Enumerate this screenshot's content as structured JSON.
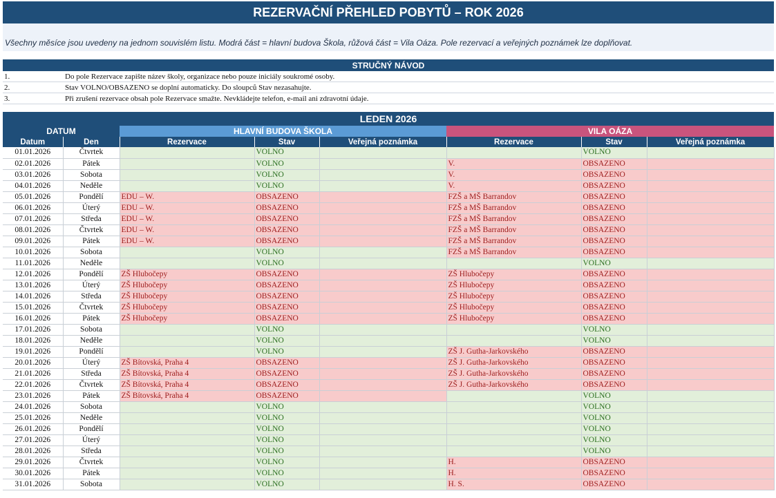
{
  "sheet": {
    "title": "REZERVAČNÍ PŘEHLED POBYTŮ – ROK 2026",
    "description": "Všechny měsíce jsou uvedeny na jednom souvislém listu. Modrá část = hlavní budova Škola, růžová část = Vila Oáza. Pole rezervací a veřejných poznámek lze doplňovat."
  },
  "guide": {
    "title": "STRUČNÝ NÁVOD",
    "items": [
      {
        "num": "1.",
        "text": "Do pole Rezervace zapište název školy, organizace nebo pouze iniciály soukromé osoby."
      },
      {
        "num": "2.",
        "text": "Stav VOLNO/OBSAZENO se doplní automaticky. Do sloupců Stav nezasahujte."
      },
      {
        "num": "3.",
        "text": "Při zrušení rezervace obsah pole Rezervace smažte. Nevkládejte telefon, e-mail ani zdravotní údaje."
      }
    ]
  },
  "month": {
    "title": "LEDEN 2026",
    "groups": {
      "datum": "DATUM",
      "school": "HLAVNÍ BUDOVA ŠKOLA",
      "vila": "VILA OÁZA"
    },
    "headers": [
      "Datum",
      "Den",
      "Rezervace",
      "Stav",
      "Veřejná poznámka",
      "Rezervace",
      "Stav",
      "Veřejná poznámka"
    ],
    "rows": [
      {
        "date": "01.01.2026",
        "day": "Čtvrtek",
        "school_res": "",
        "school_status": "VOLNO",
        "vila_res": "",
        "vila_status": "VOLNO"
      },
      {
        "date": "02.01.2026",
        "day": "Pátek",
        "school_res": "",
        "school_status": "VOLNO",
        "vila_res": "V.",
        "vila_status": "OBSAZENO"
      },
      {
        "date": "03.01.2026",
        "day": "Sobota",
        "school_res": "",
        "school_status": "VOLNO",
        "vila_res": "V.",
        "vila_status": "OBSAZENO"
      },
      {
        "date": "04.01.2026",
        "day": "Neděle",
        "school_res": "",
        "school_status": "VOLNO",
        "vila_res": "V.",
        "vila_status": "OBSAZENO"
      },
      {
        "date": "05.01.2026",
        "day": "Pondělí",
        "school_res": "EDU – W.",
        "school_status": "OBSAZENO",
        "vila_res": "FZŠ a MŠ Barrandov",
        "vila_status": "OBSAZENO"
      },
      {
        "date": "06.01.2026",
        "day": "Úterý",
        "school_res": "EDU – W.",
        "school_status": "OBSAZENO",
        "vila_res": "FZŠ a MŠ Barrandov",
        "vila_status": "OBSAZENO"
      },
      {
        "date": "07.01.2026",
        "day": "Středa",
        "school_res": "EDU – W.",
        "school_status": "OBSAZENO",
        "vila_res": "FZŠ a MŠ Barrandov",
        "vila_status": "OBSAZENO"
      },
      {
        "date": "08.01.2026",
        "day": "Čtvrtek",
        "school_res": "EDU – W.",
        "school_status": "OBSAZENO",
        "vila_res": "FZŠ a MŠ Barrandov",
        "vila_status": "OBSAZENO"
      },
      {
        "date": "09.01.2026",
        "day": "Pátek",
        "school_res": "EDU – W.",
        "school_status": "OBSAZENO",
        "vila_res": "FZŠ a MŠ Barrandov",
        "vila_status": "OBSAZENO"
      },
      {
        "date": "10.01.2026",
        "day": "Sobota",
        "school_res": "",
        "school_status": "VOLNO",
        "vila_res": "FZŠ a MŠ Barrandov",
        "vila_status": "OBSAZENO"
      },
      {
        "date": "11.01.2026",
        "day": "Neděle",
        "school_res": "",
        "school_status": "VOLNO",
        "vila_res": "",
        "vila_status": "VOLNO"
      },
      {
        "date": "12.01.2026",
        "day": "Pondělí",
        "school_res": "ZŠ Hlubočepy",
        "school_status": "OBSAZENO",
        "vila_res": "ZŠ Hlubočepy",
        "vila_status": "OBSAZENO"
      },
      {
        "date": "13.01.2026",
        "day": "Úterý",
        "school_res": "ZŠ Hlubočepy",
        "school_status": "OBSAZENO",
        "vila_res": "ZŠ Hlubočepy",
        "vila_status": "OBSAZENO"
      },
      {
        "date": "14.01.2026",
        "day": "Středa",
        "school_res": "ZŠ Hlubočepy",
        "school_status": "OBSAZENO",
        "vila_res": "ZŠ Hlubočepy",
        "vila_status": "OBSAZENO"
      },
      {
        "date": "15.01.2026",
        "day": "Čtvrtek",
        "school_res": "ZŠ Hlubočepy",
        "school_status": "OBSAZENO",
        "vila_res": "ZŠ Hlubočepy",
        "vila_status": "OBSAZENO"
      },
      {
        "date": "16.01.2026",
        "day": "Pátek",
        "school_res": "ZŠ Hlubočepy",
        "school_status": "OBSAZENO",
        "vila_res": "ZŠ Hlubočepy",
        "vila_status": "OBSAZENO"
      },
      {
        "date": "17.01.2026",
        "day": "Sobota",
        "school_res": "",
        "school_status": "VOLNO",
        "vila_res": "",
        "vila_status": "VOLNO"
      },
      {
        "date": "18.01.2026",
        "day": "Neděle",
        "school_res": "",
        "school_status": "VOLNO",
        "vila_res": "",
        "vila_status": "VOLNO"
      },
      {
        "date": "19.01.2026",
        "day": "Pondělí",
        "school_res": "",
        "school_status": "VOLNO",
        "vila_res": "ZŠ J. Gutha-Jarkovského",
        "vila_status": "OBSAZENO"
      },
      {
        "date": "20.01.2026",
        "day": "Úterý",
        "school_res": "ZŠ Bítovská, Praha 4",
        "school_status": "OBSAZENO",
        "vila_res": "ZŠ J. Gutha-Jarkovského",
        "vila_status": "OBSAZENO"
      },
      {
        "date": "21.01.2026",
        "day": "Středa",
        "school_res": "ZŠ Bítovská, Praha 4",
        "school_status": "OBSAZENO",
        "vila_res": "ZŠ J. Gutha-Jarkovského",
        "vila_status": "OBSAZENO"
      },
      {
        "date": "22.01.2026",
        "day": "Čtvrtek",
        "school_res": "ZŠ Bítovská, Praha 4",
        "school_status": "OBSAZENO",
        "vila_res": "ZŠ J. Gutha-Jarkovského",
        "vila_status": "OBSAZENO"
      },
      {
        "date": "23.01.2026",
        "day": "Pátek",
        "school_res": "ZŠ Bítovská, Praha 4",
        "school_status": "OBSAZENO",
        "vila_res": "",
        "vila_status": "VOLNO"
      },
      {
        "date": "24.01.2026",
        "day": "Sobota",
        "school_res": "",
        "school_status": "VOLNO",
        "vila_res": "",
        "vila_status": "VOLNO"
      },
      {
        "date": "25.01.2026",
        "day": "Neděle",
        "school_res": "",
        "school_status": "VOLNO",
        "vila_res": "",
        "vila_status": "VOLNO"
      },
      {
        "date": "26.01.2026",
        "day": "Pondělí",
        "school_res": "",
        "school_status": "VOLNO",
        "vila_res": "",
        "vila_status": "VOLNO"
      },
      {
        "date": "27.01.2026",
        "day": "Úterý",
        "school_res": "",
        "school_status": "VOLNO",
        "vila_res": "",
        "vila_status": "VOLNO"
      },
      {
        "date": "28.01.2026",
        "day": "Středa",
        "school_res": "",
        "school_status": "VOLNO",
        "vila_res": "",
        "vila_status": "VOLNO"
      },
      {
        "date": "29.01.2026",
        "day": "Čtvrtek",
        "school_res": "",
        "school_status": "VOLNO",
        "vila_res": "H.",
        "vila_status": "OBSAZENO"
      },
      {
        "date": "30.01.2026",
        "day": "Pátek",
        "school_res": "",
        "school_status": "VOLNO",
        "vila_res": "H.",
        "vila_status": "OBSAZENO"
      },
      {
        "date": "31.01.2026",
        "day": "Sobota",
        "school_res": "",
        "school_status": "VOLNO",
        "vila_res": "H. S.",
        "vila_status": "OBSAZENO"
      }
    ]
  },
  "colors": {
    "header_dark": "#1f4e79",
    "school_band": "#5b9bd5",
    "vila_band": "#c9547d",
    "free_fill": "#e2efda",
    "busy_fill": "#f8cbcb"
  }
}
